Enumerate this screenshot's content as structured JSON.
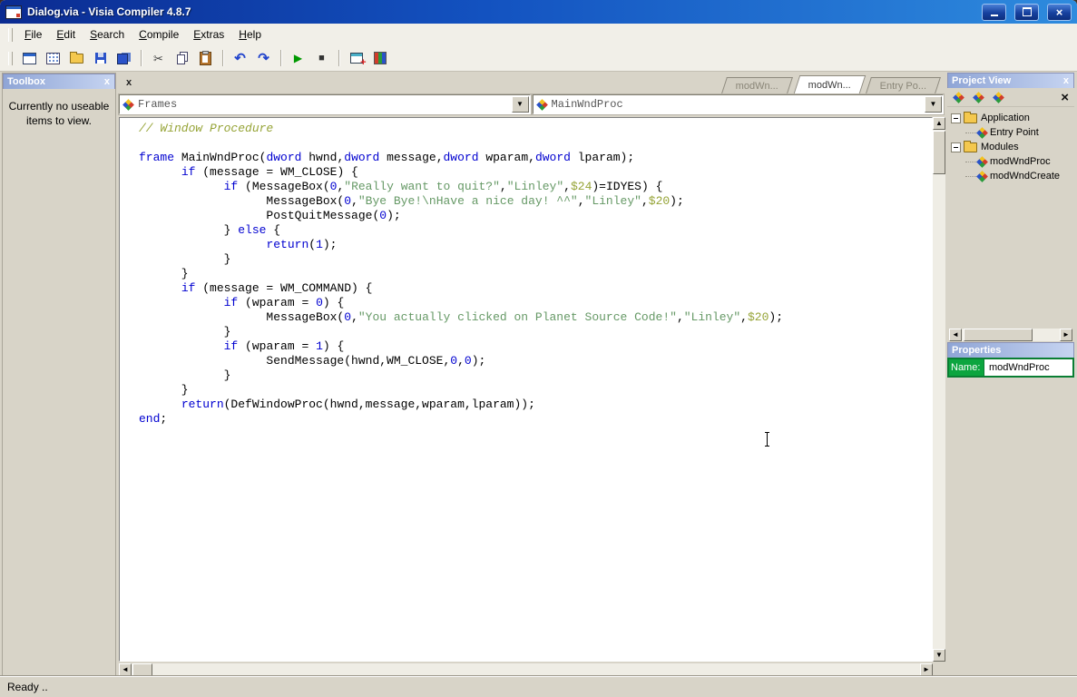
{
  "window": {
    "title": "Dialog.via - Visia Compiler 4.8.7"
  },
  "glyphs": {
    "close": "×",
    "combo_arrow": "▼",
    "up": "▲",
    "down": "▼",
    "left": "◄",
    "right": "►",
    "small_close": "x",
    "delete": "×"
  },
  "menu": {
    "items": [
      {
        "label": "File",
        "u": 0
      },
      {
        "label": "Edit",
        "u": 0
      },
      {
        "label": "Search",
        "u": 0
      },
      {
        "label": "Compile",
        "u": 0
      },
      {
        "label": "Extras",
        "u": 0
      },
      {
        "label": "Help",
        "u": 0
      }
    ]
  },
  "toolbar": {
    "buttons": [
      {
        "name": "new-window-button",
        "icon": "new"
      },
      {
        "name": "form-editor-button",
        "icon": "form"
      },
      {
        "name": "open-button",
        "icon": "folder"
      },
      {
        "name": "save-button",
        "icon": "save"
      },
      {
        "name": "save-all-button",
        "icon": "saveall"
      },
      {
        "sep": true
      },
      {
        "name": "cut-button",
        "icon": "cut",
        "glyph": "✂"
      },
      {
        "name": "copy-button",
        "icon": "copy"
      },
      {
        "name": "paste-button",
        "icon": "paste"
      },
      {
        "sep": true
      },
      {
        "name": "undo-button",
        "icon": "undo",
        "glyph": "↶"
      },
      {
        "name": "redo-button",
        "icon": "redo",
        "glyph": "↷"
      },
      {
        "sep": true
      },
      {
        "name": "run-button",
        "icon": "run",
        "glyph": "▶"
      },
      {
        "name": "stop-button",
        "icon": "stop",
        "glyph": "■"
      },
      {
        "sep": true
      },
      {
        "name": "add-window-button",
        "icon": "addwin"
      },
      {
        "name": "modules-button",
        "icon": "blocks"
      }
    ]
  },
  "toolbox": {
    "title": "Toolbox",
    "message": "Currently no useable items to view."
  },
  "editor": {
    "tabs": [
      {
        "label": "modWn...",
        "active": false,
        "name": "tab-modwndcreate"
      },
      {
        "label": "modWn...",
        "active": true,
        "name": "tab-modwndproc"
      },
      {
        "label": "Entry Po...",
        "active": false,
        "name": "tab-entry-point"
      }
    ],
    "combos": [
      {
        "value": "Frames"
      },
      {
        "value": "MainWndProc"
      }
    ],
    "code_lines": [
      [
        [
          "c",
          "// Window Procedure"
        ]
      ],
      [],
      [
        [
          "k",
          "frame"
        ],
        [
          "p",
          " MainWndProc("
        ],
        [
          "k",
          "dword"
        ],
        [
          "p",
          " hwnd,"
        ],
        [
          "k",
          "dword"
        ],
        [
          "p",
          " message,"
        ],
        [
          "k",
          "dword"
        ],
        [
          "p",
          " wparam,"
        ],
        [
          "k",
          "dword"
        ],
        [
          "p",
          " lparam);"
        ]
      ],
      [
        [
          "p",
          "      "
        ],
        [
          "k",
          "if"
        ],
        [
          "p",
          " (message = WM_CLOSE) {"
        ]
      ],
      [
        [
          "p",
          "            "
        ],
        [
          "k",
          "if"
        ],
        [
          "p",
          " (MessageBox("
        ],
        [
          "n",
          "0"
        ],
        [
          "p",
          ","
        ],
        [
          "s",
          "\"Really want to quit?\""
        ],
        [
          "p",
          ","
        ],
        [
          "s",
          "\"Linley\""
        ],
        [
          "p",
          ","
        ],
        [
          "h",
          "$24"
        ],
        [
          "p",
          ")=IDYES) {"
        ]
      ],
      [
        [
          "p",
          "                  MessageBox("
        ],
        [
          "n",
          "0"
        ],
        [
          "p",
          ","
        ],
        [
          "s",
          "\"Bye Bye!\\nHave a nice day! ^^\""
        ],
        [
          "p",
          ","
        ],
        [
          "s",
          "\"Linley\""
        ],
        [
          "p",
          ","
        ],
        [
          "h",
          "$20"
        ],
        [
          "p",
          ");"
        ]
      ],
      [
        [
          "p",
          "                  PostQuitMessage("
        ],
        [
          "n",
          "0"
        ],
        [
          "p",
          ");"
        ]
      ],
      [
        [
          "p",
          "            } "
        ],
        [
          "k",
          "else"
        ],
        [
          "p",
          " {"
        ]
      ],
      [
        [
          "p",
          "                  "
        ],
        [
          "k",
          "return"
        ],
        [
          "p",
          "("
        ],
        [
          "n",
          "1"
        ],
        [
          "p",
          ");"
        ]
      ],
      [
        [
          "p",
          "            }"
        ]
      ],
      [
        [
          "p",
          "      }"
        ]
      ],
      [
        [
          "p",
          "      "
        ],
        [
          "k",
          "if"
        ],
        [
          "p",
          " (message = WM_COMMAND) {"
        ]
      ],
      [
        [
          "p",
          "            "
        ],
        [
          "k",
          "if"
        ],
        [
          "p",
          " (wparam = "
        ],
        [
          "n",
          "0"
        ],
        [
          "p",
          ") {"
        ]
      ],
      [
        [
          "p",
          "                  MessageBox("
        ],
        [
          "n",
          "0"
        ],
        [
          "p",
          ","
        ],
        [
          "s",
          "\"You actually clicked on Planet Source Code!\""
        ],
        [
          "p",
          ","
        ],
        [
          "s",
          "\"Linley\""
        ],
        [
          "p",
          ","
        ],
        [
          "h",
          "$20"
        ],
        [
          "p",
          ");"
        ]
      ],
      [
        [
          "p",
          "            }"
        ]
      ],
      [
        [
          "p",
          "            "
        ],
        [
          "k",
          "if"
        ],
        [
          "p",
          " (wparam = "
        ],
        [
          "n",
          "1"
        ],
        [
          "p",
          ") {"
        ]
      ],
      [
        [
          "p",
          "                  SendMessage(hwnd,WM_CLOSE,"
        ],
        [
          "n",
          "0"
        ],
        [
          "p",
          ","
        ],
        [
          "n",
          "0"
        ],
        [
          "p",
          ");"
        ]
      ],
      [
        [
          "p",
          "            }"
        ]
      ],
      [
        [
          "p",
          "      }"
        ]
      ],
      [
        [
          "p",
          "      "
        ],
        [
          "k",
          "return"
        ],
        [
          "p",
          "(DefWindowProc(hwnd,message,wparam,lparam));"
        ]
      ],
      [
        [
          "k",
          "end"
        ],
        [
          "p",
          ";"
        ]
      ]
    ]
  },
  "project_view": {
    "title": "Project View",
    "tree": [
      {
        "level": 0,
        "expand": true,
        "icon": "folder",
        "label": "Application",
        "name": "tree-item-application"
      },
      {
        "level": 1,
        "expand": false,
        "icon": "star",
        "label": "Entry Point",
        "name": "tree-item-entry-point"
      },
      {
        "level": 0,
        "expand": true,
        "icon": "folder",
        "label": "Modules",
        "name": "tree-item-modules"
      },
      {
        "level": 1,
        "expand": false,
        "icon": "star",
        "label": "modWndProc",
        "name": "tree-item-modwndproc"
      },
      {
        "level": 1,
        "expand": false,
        "icon": "star",
        "label": "modWndCreate",
        "name": "tree-item-modwndcreate"
      }
    ]
  },
  "properties": {
    "title": "Properties",
    "rows": [
      {
        "label": "Name:",
        "value": "modWndProc"
      }
    ]
  },
  "status_bar": {
    "text": "Ready .."
  },
  "colors": {
    "keyword": "#0000D0",
    "comment": "#96A437",
    "string": "#669966",
    "hexnum": "#96A437",
    "number": "#0000D0",
    "properties_green": "#0CA53F",
    "properties_border": "#0A7E33",
    "titlebar_left": "#0B2B91",
    "titlebar_right": "#2E8BDE",
    "panel_header_left": "#8FA5D6",
    "panel_header_right": "#C6D4F1",
    "run_green": "#009900"
  }
}
